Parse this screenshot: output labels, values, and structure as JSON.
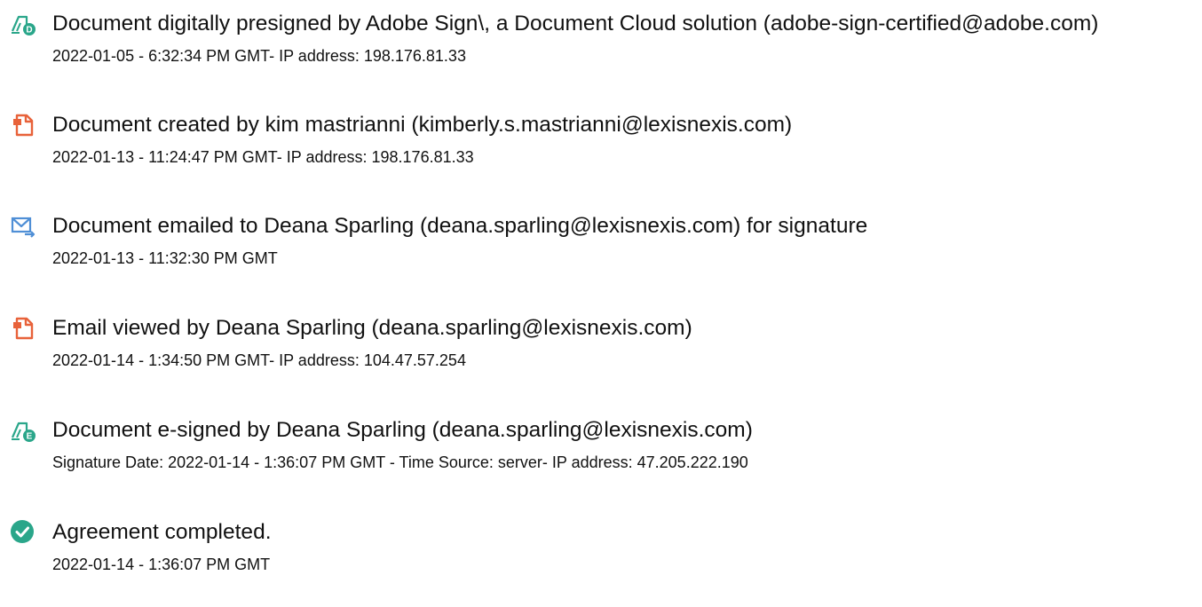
{
  "colors": {
    "sign_icon": "#2aa68a",
    "doc_icon": "#e8623a",
    "mail_icon": "#4f8fd6",
    "check_icon": "#2aa68a",
    "text": "#111111"
  },
  "events": [
    {
      "icon": "pen-badge-d-icon",
      "title": "Document digitally presigned by Adobe Sign\\, a Document Cloud solution (adobe-sign-certified@adobe.com)",
      "detail": "2022-01-05 - 6:32:34 PM GMT- IP address: 198.176.81.33"
    },
    {
      "icon": "document-icon",
      "title": "Document created by kim mastrianni (kimberly.s.mastrianni@lexisnexis.com)",
      "detail": "2022-01-13 - 11:24:47 PM GMT- IP address: 198.176.81.33"
    },
    {
      "icon": "mail-forward-icon",
      "title": "Document emailed to Deana Sparling (deana.sparling@lexisnexis.com) for signature",
      "detail": "2022-01-13 - 11:32:30 PM GMT"
    },
    {
      "icon": "document-icon",
      "title": "Email viewed by Deana Sparling (deana.sparling@lexisnexis.com)",
      "detail": "2022-01-14 - 1:34:50 PM GMT- IP address: 104.47.57.254"
    },
    {
      "icon": "pen-badge-e-icon",
      "title": "Document e-signed by Deana Sparling (deana.sparling@lexisnexis.com)",
      "detail": "Signature Date: 2022-01-14 - 1:36:07 PM GMT - Time Source: server- IP address: 47.205.222.190"
    },
    {
      "icon": "check-circle-icon",
      "title": "Agreement completed.",
      "detail": "2022-01-14 - 1:36:07 PM GMT"
    }
  ]
}
